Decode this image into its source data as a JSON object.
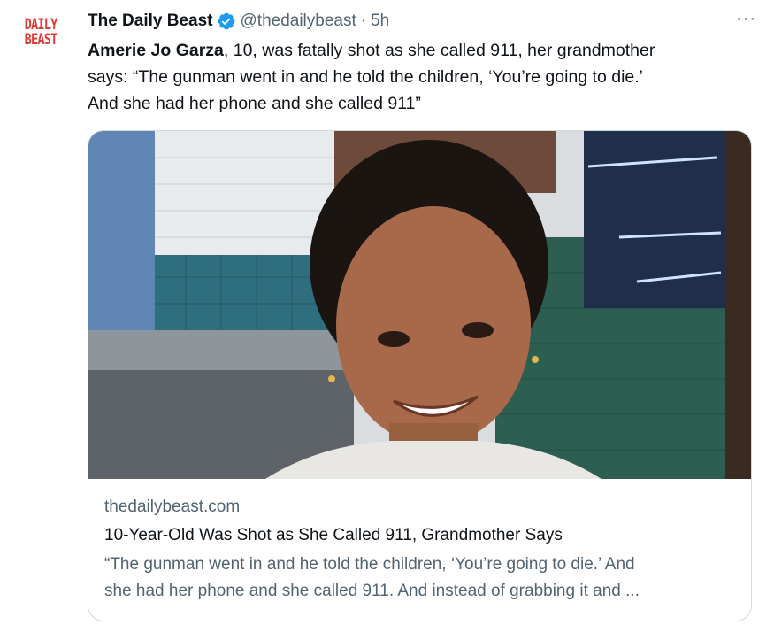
{
  "author": {
    "avatar_text_line1": "DAILY",
    "avatar_text_line2": "BEAST",
    "display_name": "The Daily Beast",
    "verified": true,
    "handle": "@thedailybeast",
    "separator": "·",
    "time": "5h"
  },
  "more_menu_label": "···",
  "tweet": {
    "name_bold": "Amerie Jo Garza",
    "text_line1": ", 10, was fatally shot as she called 911, her grandmother",
    "text_line2": "says: “The gunman went in and he told the children, ‘You’re going to die.’",
    "text_line3": "And she had her phone and she called 911”"
  },
  "card": {
    "domain": "thedailybeast.com",
    "title": "10-Year-Old Was Shot as She Called 911, Grandmother Says",
    "description_line1": "“The gunman went in and he told the children, ‘You’re going to die.’ And",
    "description_line2": "she had her phone and she called 911. And instead of grabbing it and ..."
  },
  "colors": {
    "brand_red": "#e23b33",
    "verified_blue": "#1d9bf0",
    "text_primary": "#0f1419",
    "text_secondary": "#536471",
    "border": "#cfd9de"
  }
}
